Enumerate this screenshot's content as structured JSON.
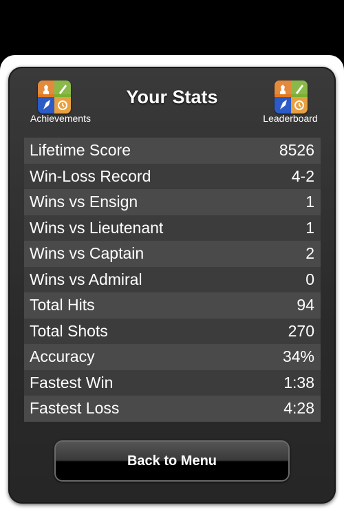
{
  "header": {
    "title": "Your Stats",
    "achievements_label": "Achievements",
    "leaderboard_label": "Leaderboard"
  },
  "stats": [
    {
      "label": "Lifetime Score",
      "value": "8526"
    },
    {
      "label": "Win-Loss Record",
      "value": "4-2"
    },
    {
      "label": "Wins vs Ensign",
      "value": "1"
    },
    {
      "label": "Wins vs Lieutenant",
      "value": "1"
    },
    {
      "label": "Wins vs Captain",
      "value": "2"
    },
    {
      "label": "Wins vs Admiral",
      "value": "0"
    },
    {
      "label": "Total Hits",
      "value": "94"
    },
    {
      "label": "Total Shots",
      "value": "270"
    },
    {
      "label": "Accuracy",
      "value": "34%"
    },
    {
      "label": "Fastest Win",
      "value": "1:38"
    },
    {
      "label": "Fastest Loss",
      "value": "4:28"
    }
  ],
  "footer": {
    "back_label": "Back to Menu"
  },
  "icons": {
    "game_center": "game-center-icon"
  },
  "colors": {
    "panel": "#2e2e2e",
    "row_light": "#4a4a4a",
    "row_dark": "#3c3c3c",
    "gc_orange": "#e07a22",
    "gc_green": "#7bb030",
    "gc_blue": "#2c5bc8",
    "gc_peach": "#e8a040"
  }
}
